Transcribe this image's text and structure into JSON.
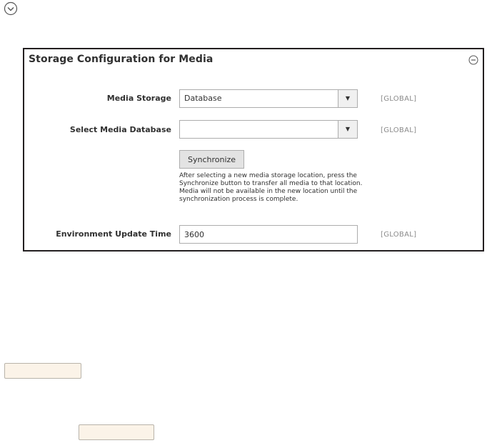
{
  "top_toggle_icon": "chevron-down-circle-icon",
  "panel": {
    "title": "Storage Configuration for Media",
    "collapse_icon": "minus-circle-icon"
  },
  "fields": {
    "media_storage": {
      "label": "Media Storage",
      "value": "Database",
      "scope": "[GLOBAL]"
    },
    "media_database": {
      "label": "Select Media Database",
      "value": "",
      "scope": "[GLOBAL]"
    },
    "synchronize": {
      "button_label": "Synchronize",
      "note": "After selecting a new media storage location, press the Synchronize button to transfer all media to that location. Media will not be available in the new location until the synchronization process is complete."
    },
    "env_update_time": {
      "label": "Environment Update Time",
      "value": "3600",
      "scope": "[GLOBAL]"
    }
  }
}
